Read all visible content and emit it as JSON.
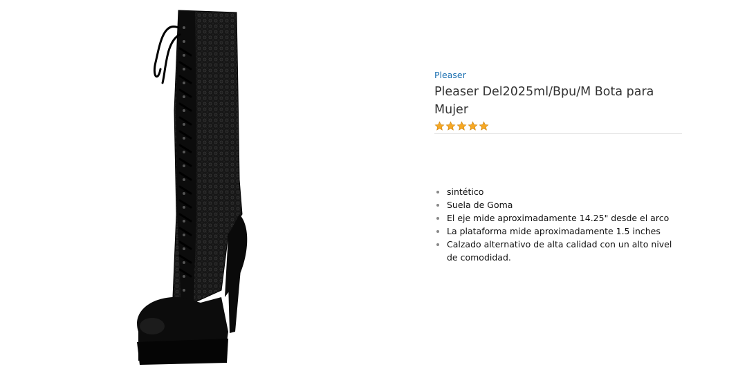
{
  "product": {
    "brand": "Pleaser",
    "title": "Pleaser Del2025ml/Bpu/M Bota para Mujer",
    "rating": {
      "stars": 5,
      "max": 5,
      "color": "#f7a823"
    },
    "features": [
      "sintético",
      "Suela de Goma",
      "El eje mide aproximadamente 14.25\" desde el arco",
      "La plataforma mide aproximadamente 1.5 inches",
      "Calzado alternativo de alta calidad con un alto nivel de comodidad."
    ]
  },
  "colors": {
    "link": "#1a6fb0",
    "boot": "#111111"
  },
  "icons": {
    "star": "star-icon",
    "bullet": "bullet-icon"
  }
}
